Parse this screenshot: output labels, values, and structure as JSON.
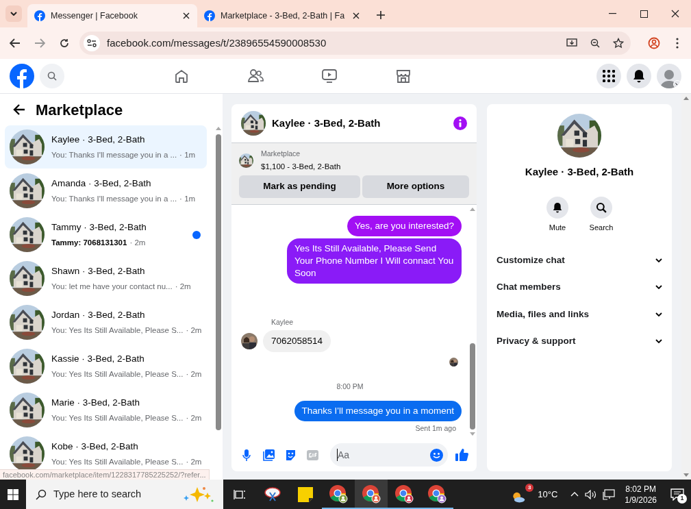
{
  "browser": {
    "tabs": [
      {
        "title": "Messenger | Facebook",
        "selected": true
      },
      {
        "title": "Marketplace - 3-Bed, 2-Bath | Fa",
        "selected": false
      }
    ],
    "url": "facebook.com/messages/t/23896554590008530",
    "status_url": "facebook.com/marketplace/item/1228317785225252/?refer..."
  },
  "sidebar": {
    "title": "Marketplace",
    "conversations": [
      {
        "title": "Kaylee · 3-Bed, 2-Bath",
        "preview": "You: Thanks I'll message you in a ...",
        "time": "· 1m",
        "selected": true,
        "unread": false
      },
      {
        "title": "Amanda · 3-Bed, 2-Bath",
        "preview": "You: Thanks I'll message you in a ...",
        "time": "· 1m",
        "selected": false,
        "unread": false
      },
      {
        "title": "Tammy · 3-Bed, 2-Bath",
        "preview": "Tammy: 7068131301",
        "time": "· 2m",
        "selected": false,
        "unread": true
      },
      {
        "title": "Shawn · 3-Bed, 2-Bath",
        "preview": "You: let me have your contact nu...",
        "time": "· 2m",
        "selected": false,
        "unread": false
      },
      {
        "title": "Jordan · 3-Bed, 2-Bath",
        "preview": "You: Yes Its Still Available, Please S...",
        "time": "· 2m",
        "selected": false,
        "unread": false
      },
      {
        "title": "Kassie · 3-Bed, 2-Bath",
        "preview": "You: Yes Its Still Available, Please S...",
        "time": "· 2m",
        "selected": false,
        "unread": false
      },
      {
        "title": "Marie · 3-Bed, 2-Bath",
        "preview": "You: Yes Its Still Available, Please S...",
        "time": "· 2m",
        "selected": false,
        "unread": false
      },
      {
        "title": "Kobe · 3-Bed, 2-Bath",
        "preview": "You: Yes Its Still Available, Please S...",
        "time": "· 2m",
        "selected": false,
        "unread": false
      }
    ]
  },
  "chat": {
    "title": "Kaylee · 3-Bed, 2-Bath",
    "listing": {
      "label": "Marketplace",
      "price": "$1,100 - 3-Bed, 2-Bath"
    },
    "actions": [
      "Mark as pending",
      "More options"
    ],
    "messages": [
      {
        "kind": "sent",
        "text": "Yes, are you interested?",
        "color": "#a20ff4"
      },
      {
        "kind": "sent",
        "text": "Yes Its Still Available, Please Send Your Phone Number I Will connact You Soon",
        "color": "#8a1bf7"
      },
      {
        "kind": "received",
        "sender": "Kaylee",
        "text": "7062058514"
      },
      {
        "kind": "seen"
      },
      {
        "kind": "time",
        "text": "8:00 PM"
      },
      {
        "kind": "sent",
        "text": "Thanks I'll message you in a moment",
        "color": "#0a6cf0"
      },
      {
        "kind": "status",
        "text": "Sent 1m ago"
      }
    ],
    "composer": {
      "placeholder": "Aa"
    }
  },
  "info": {
    "name": "Kaylee · 3-Bed, 2-Bath",
    "actions": [
      {
        "kind": "mute",
        "label": "Mute"
      },
      {
        "kind": "search",
        "label": "Search"
      }
    ],
    "sections": [
      {
        "label": "Customize chat",
        "expanded": false
      },
      {
        "label": "Chat members",
        "expanded": false
      },
      {
        "label": "Media, files and links",
        "expanded": false
      },
      {
        "label": "Privacy & support",
        "expanded": false
      }
    ]
  },
  "taskbar": {
    "search_placeholder": "Type here to search",
    "weather_badge": "3",
    "temperature": "10°C",
    "time": "8:02 PM",
    "date": "1/9/2026",
    "notifications": "1"
  }
}
